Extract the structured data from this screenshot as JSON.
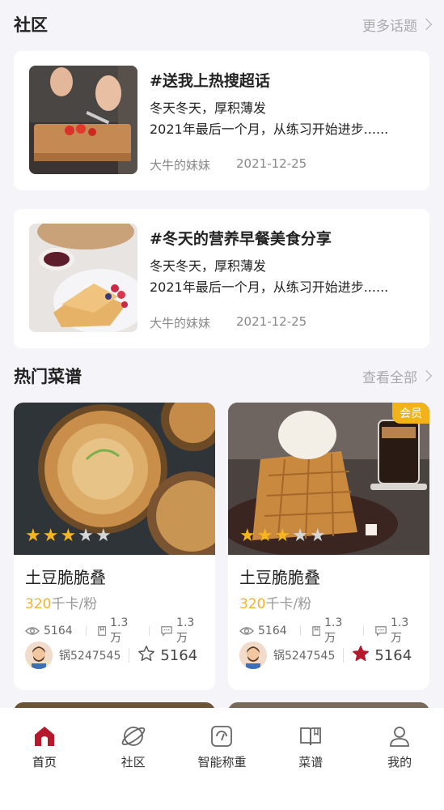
{
  "community": {
    "title": "社区",
    "more": "更多话题",
    "topics": [
      {
        "title": "#送我上热搜超话",
        "line1": "冬天冬天，厚积薄发",
        "line2": "2021年最后一个月，从练习开始进步......",
        "author": "大牛的妹妹",
        "date": "2021-12-25"
      },
      {
        "title": "#冬天的营养早餐美食分享",
        "line1": "冬天冬天，厚积薄发",
        "line2": "2021年最后一个月，从练习开始进步......",
        "author": "大牛的妹妹",
        "date": "2021-12-25"
      }
    ]
  },
  "recipes": {
    "title": "热门菜谱",
    "more": "查看全部",
    "items": [
      {
        "name": "土豆脆脆叠",
        "cal_value": "320",
        "cal_unit": "千卡/粉",
        "views": "5164",
        "saves": "1.3万",
        "comments": "1.3万",
        "author": "锅5247545",
        "favorites": "5164",
        "rating": 3,
        "rating_max": 5,
        "favorited": false,
        "badge": ""
      },
      {
        "name": "土豆脆脆叠",
        "cal_value": "320",
        "cal_unit": "千卡/粉",
        "views": "5164",
        "saves": "1.3万",
        "comments": "1.3万",
        "author": "锅5247545",
        "favorites": "5164",
        "rating": 3,
        "rating_max": 5,
        "favorited": true,
        "badge": "会员"
      }
    ]
  },
  "tabbar": {
    "items": [
      {
        "label": "首页",
        "icon": "home-icon",
        "active": true
      },
      {
        "label": "社区",
        "icon": "planet-icon",
        "active": false
      },
      {
        "label": "智能称重",
        "icon": "scale-icon",
        "active": false
      },
      {
        "label": "菜谱",
        "icon": "book-icon",
        "active": false
      },
      {
        "label": "我的",
        "icon": "user-icon",
        "active": false
      }
    ]
  },
  "colors": {
    "accent": "#b5192b",
    "star": "#f5b51e",
    "calorie": "#f0b429",
    "badge": "#f2b21a"
  }
}
